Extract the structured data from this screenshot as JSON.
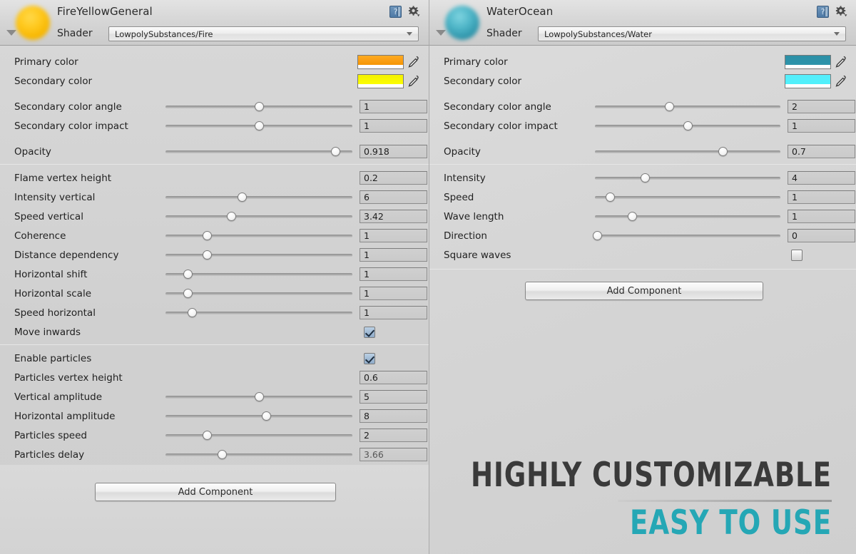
{
  "panels": [
    {
      "title": "FireYellowGeneral",
      "shader_label": "Shader",
      "shader_value": "LowpolySubstances/Fire",
      "preview_icon": "fire-sphere-preview",
      "help_icon": "help-book-icon",
      "gear_icon": "gear-icon",
      "foldout_icon": "foldout-triangle-icon",
      "add_component_label": "Add Component",
      "groups": [
        {
          "rows": [
            {
              "type": "color",
              "label": "Primary color",
              "color": "#f59200",
              "color_top": "#ffaa22",
              "alpha": "#ffffff",
              "eyedropper": "eyedropper-icon"
            },
            {
              "type": "color",
              "label": "Secondary color",
              "color": "#fdff00",
              "color_top": "#f3f000",
              "alpha": "#ffffff",
              "eyedropper": "eyedropper-icon"
            }
          ]
        },
        {
          "rows": [
            {
              "type": "slider",
              "label": "Secondary color angle",
              "value": "1",
              "pos": 50
            },
            {
              "type": "slider",
              "label": "Secondary color impact",
              "value": "1",
              "pos": 50
            }
          ]
        },
        {
          "rows": [
            {
              "type": "slider",
              "label": "Opacity",
              "value": "0.918",
              "pos": 91
            }
          ]
        },
        {
          "rows": [
            {
              "type": "field",
              "label": "Flame vertex height",
              "value": "0.2"
            },
            {
              "type": "slider",
              "label": "Intensity vertical",
              "value": "6",
              "pos": 41
            },
            {
              "type": "slider",
              "label": "Speed vertical",
              "value": "3.42",
              "pos": 35
            },
            {
              "type": "slider",
              "label": "Coherence",
              "value": "1",
              "pos": 22
            },
            {
              "type": "slider",
              "label": "Distance dependency",
              "value": "1",
              "pos": 22
            },
            {
              "type": "slider",
              "label": "Horizontal shift",
              "value": "1",
              "pos": 12
            },
            {
              "type": "slider",
              "label": "Horizontal scale",
              "value": "1",
              "pos": 12
            },
            {
              "type": "slider",
              "label": "Speed horizontal",
              "value": "1",
              "pos": 14
            },
            {
              "type": "checkbox",
              "label": "Move inwards",
              "checked": true
            }
          ]
        },
        {
          "rows": [
            {
              "type": "checkbox",
              "label": "Enable particles",
              "checked": true
            },
            {
              "type": "field",
              "label": "Particles vertex height",
              "value": "0.6"
            },
            {
              "type": "slider",
              "label": "Vertical amplitude",
              "value": "5",
              "pos": 50
            },
            {
              "type": "slider",
              "label": "Horizontal amplitude",
              "value": "8",
              "pos": 54
            },
            {
              "type": "slider",
              "label": "Particles speed",
              "value": "2",
              "pos": 22
            },
            {
              "type": "slider",
              "label": "Particles delay",
              "value": "3.66",
              "pos": 30,
              "dim": true
            }
          ]
        }
      ]
    },
    {
      "title": "WaterOcean",
      "shader_label": "Shader",
      "shader_value": "LowpolySubstances/Water",
      "preview_icon": "water-sphere-preview",
      "help_icon": "help-book-icon",
      "gear_icon": "gear-icon",
      "foldout_icon": "foldout-triangle-icon",
      "add_component_label": "Add Component",
      "groups": [
        {
          "rows": [
            {
              "type": "color",
              "label": "Primary color",
              "color": "#2e95ab",
              "color_top": "#2c8fa6",
              "alpha": "#ffffff",
              "eyedropper": "eyedropper-icon"
            },
            {
              "type": "color",
              "label": "Secondary color",
              "color": "#4ff0fb",
              "color_top": "#56eefb",
              "alpha": "#ffffff",
              "eyedropper": "eyedropper-icon"
            }
          ]
        },
        {
          "rows": [
            {
              "type": "slider",
              "label": "Secondary color angle",
              "value": "2",
              "pos": 40
            },
            {
              "type": "slider",
              "label": "Secondary color impact",
              "value": "1",
              "pos": 50
            }
          ]
        },
        {
          "rows": [
            {
              "type": "slider",
              "label": "Opacity",
              "value": "0.7",
              "pos": 69
            }
          ]
        },
        {
          "rows": [
            {
              "type": "slider",
              "label": "Intensity",
              "value": "4",
              "pos": 27
            },
            {
              "type": "slider",
              "label": "Speed",
              "value": "1",
              "pos": 8
            },
            {
              "type": "slider",
              "label": "Wave length",
              "value": "1",
              "pos": 20
            },
            {
              "type": "slider",
              "label": "Direction",
              "value": "0",
              "pos": 1
            },
            {
              "type": "checkbox",
              "label": "Square waves",
              "checked": false
            }
          ]
        }
      ]
    }
  ],
  "promo": {
    "line1": "HIGHLY CUSTOMIZABLE",
    "line2": "EASY TO USE",
    "accent_color": "#25a7b5",
    "line1_color": "#3a3a3a"
  }
}
